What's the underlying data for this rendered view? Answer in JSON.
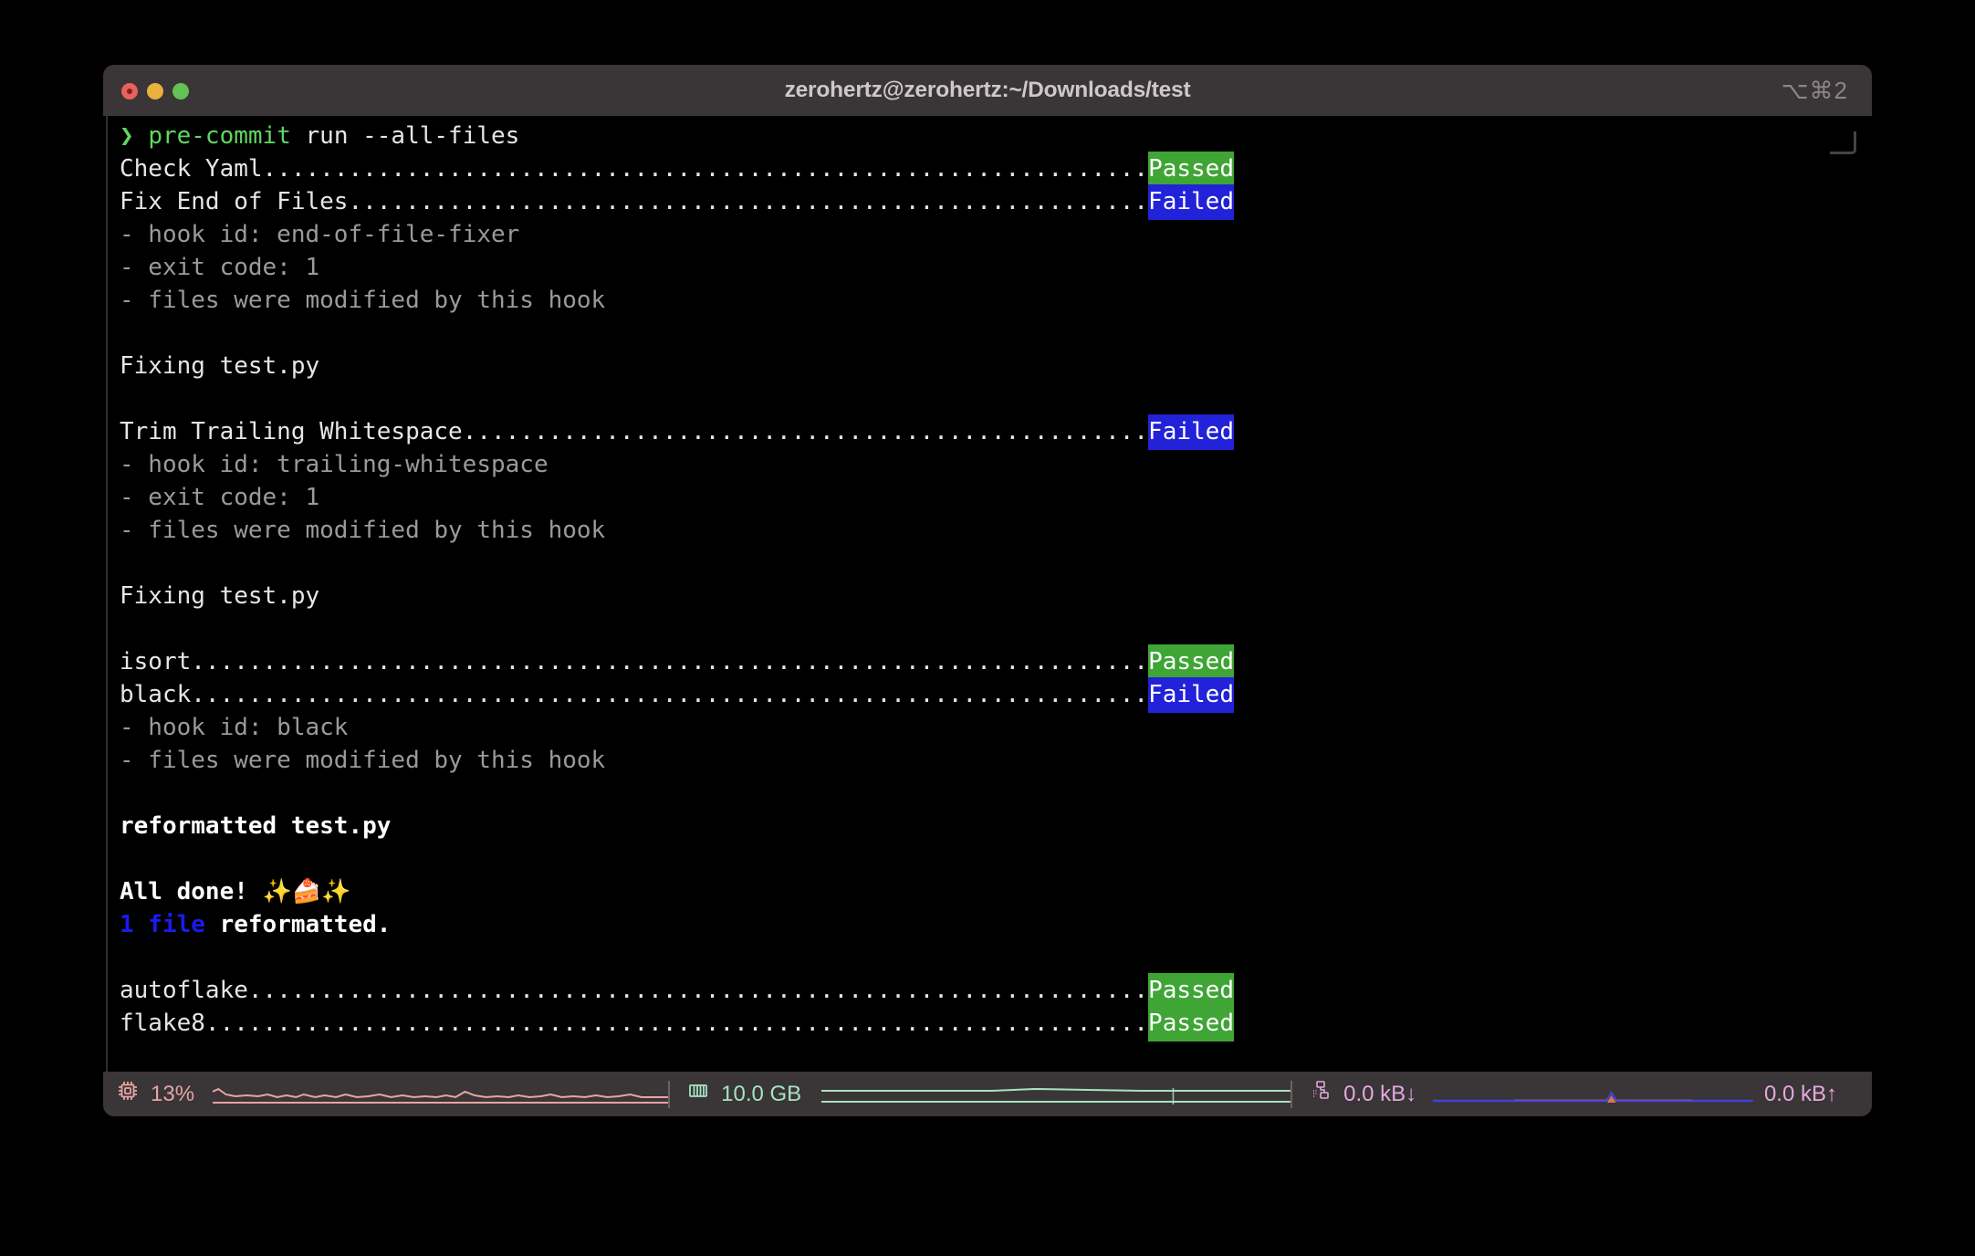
{
  "window": {
    "title": "zerohertz@zerohertz:~/Downloads/test",
    "shortcut": "⌥⌘2",
    "traffic": {
      "close": "close-button",
      "minimize": "minimize-button",
      "maximize": "maximize-button"
    }
  },
  "colors": {
    "titlebar_bg": "#3a3536",
    "terminal_bg": "#000000",
    "prompt_green": "#5fd75f",
    "passed_bg": "#3fa535",
    "failed_bg": "#2222d8",
    "dim_text": "#9a9a9a",
    "cpu": "#e7a3a5",
    "mem": "#a6e3c4",
    "net": "#e4a8e0",
    "net_graph": "#4040e0"
  },
  "terminal": {
    "prompt_symbol": "❯",
    "command_name": "pre-commit",
    "command_args": " run --all-files",
    "lines": [
      {
        "type": "check",
        "name": "Check Yaml",
        "dots": "..............................................................",
        "status": "Passed"
      },
      {
        "type": "check",
        "name": "Fix End of Files",
        "dots": "........................................................",
        "status": "Failed"
      },
      {
        "type": "dim",
        "text": "- hook id: end-of-file-fixer"
      },
      {
        "type": "dim",
        "text": "- exit code: 1"
      },
      {
        "type": "dim",
        "text": "- files were modified by this hook"
      },
      {
        "type": "blank",
        "text": ""
      },
      {
        "type": "plain",
        "text": "Fixing test.py"
      },
      {
        "type": "blank",
        "text": ""
      },
      {
        "type": "check",
        "name": "Trim Trailing Whitespace",
        "dots": "................................................",
        "status": "Failed"
      },
      {
        "type": "dim",
        "text": "- hook id: trailing-whitespace"
      },
      {
        "type": "dim",
        "text": "- exit code: 1"
      },
      {
        "type": "dim",
        "text": "- files were modified by this hook"
      },
      {
        "type": "blank",
        "text": ""
      },
      {
        "type": "plain",
        "text": "Fixing test.py"
      },
      {
        "type": "blank",
        "text": ""
      },
      {
        "type": "check",
        "name": "isort",
        "dots": "...................................................................",
        "status": "Passed"
      },
      {
        "type": "check",
        "name": "black",
        "dots": "...................................................................",
        "status": "Failed"
      },
      {
        "type": "dim",
        "text": "- hook id: black"
      },
      {
        "type": "dim",
        "text": "- files were modified by this hook"
      },
      {
        "type": "blank",
        "text": ""
      },
      {
        "type": "bold",
        "text": "reformatted test.py"
      },
      {
        "type": "blank",
        "text": ""
      },
      {
        "type": "alldone",
        "text": "All done! ",
        "emoji": "✨🍰✨"
      },
      {
        "type": "count",
        "count": "1",
        "unit": " file ",
        "rest": "reformatted."
      },
      {
        "type": "blank",
        "text": ""
      },
      {
        "type": "check",
        "name": "autoflake",
        "dots": "...............................................................",
        "status": "Passed"
      },
      {
        "type": "check",
        "name": "flake8",
        "dots": "..................................................................",
        "status": "Passed"
      }
    ]
  },
  "statusbar": {
    "cpu": {
      "icon": "cpu-icon",
      "value": "13%"
    },
    "memory": {
      "icon": "memory-icon",
      "value": "10.0 GB"
    },
    "network": {
      "icon": "network-icon",
      "download": "0.0 kB↓",
      "upload": "0.0 kB↑"
    }
  }
}
